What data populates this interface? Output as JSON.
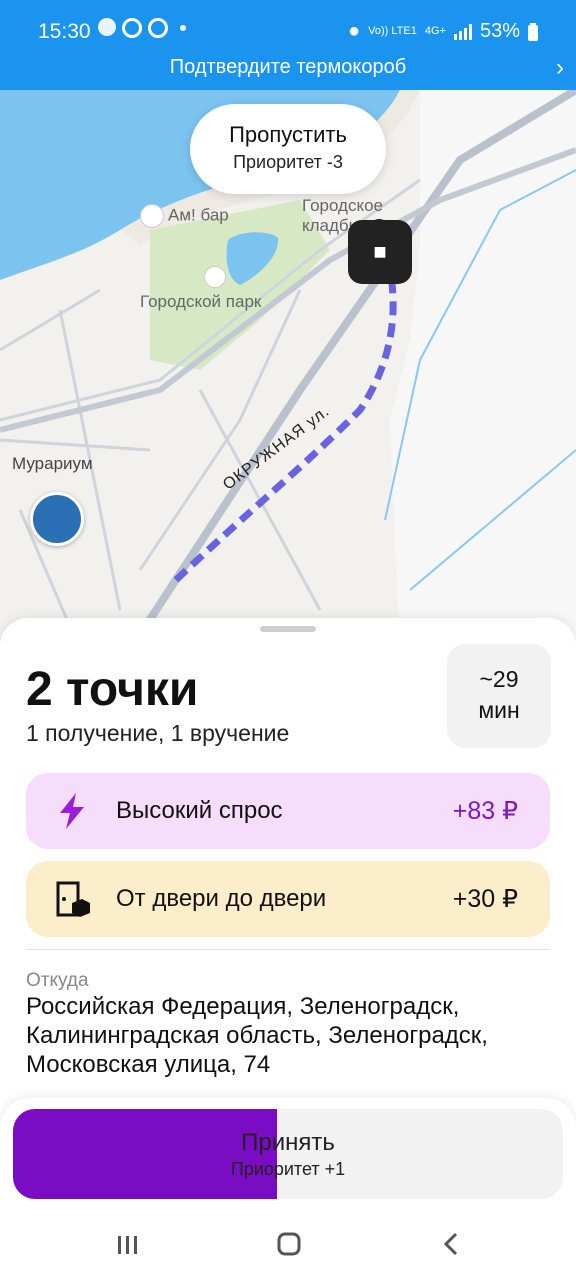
{
  "status": {
    "time": "15:30",
    "network": "Vo)) LTE1",
    "net_type": "4G+",
    "battery": "53%"
  },
  "banner": {
    "text": "Подтвердите термокороб"
  },
  "map": {
    "skip": {
      "title": "Пропустить",
      "priority": "Приоритет -3"
    },
    "labels": {
      "bar": "Ам! бар",
      "park": "Городской парк",
      "cemetery": "Городское кладбище",
      "museum": "Мурариум",
      "street": "ОКРУЖНАЯ ул."
    }
  },
  "order": {
    "title": "2 точки",
    "subtitle": "1 получение, 1 вручение",
    "eta_value": "~29",
    "eta_unit": "мин",
    "bonuses": [
      {
        "label": "Высокий спрос",
        "amount": "+83 ₽",
        "icon": "lightning-icon",
        "color": "#7d16c9"
      },
      {
        "label": "От двери до двери",
        "amount": "+30 ₽",
        "icon": "door-box-icon",
        "color": "#111111"
      }
    ],
    "from_label": "Откуда",
    "from_address": "Российская Федерация, Зеленоградск, Калининградская область, Зеленоградск, Московская улица, 74"
  },
  "accept": {
    "title": "Принять",
    "priority": "Приоритет +1",
    "progress": 0.48
  },
  "colors": {
    "accent": "#7a0dc4",
    "status_bar": "#1a94ee",
    "route": "#6a63e0"
  }
}
